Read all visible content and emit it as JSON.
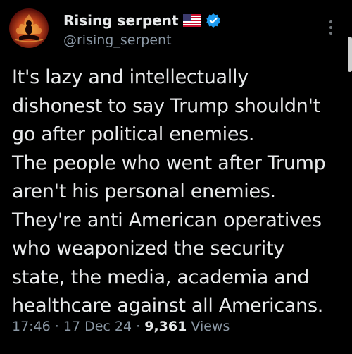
{
  "author": {
    "display_name": "Rising serpent",
    "flag_emoji": "🇺🇸",
    "handle": "@rising_serpent",
    "verified": true,
    "verified_color": "#1d9bf0",
    "avatar_icon": "serpent-flame-avatar"
  },
  "tweet": {
    "lines": [
      "It's lazy and intellectually",
      "dishonest to say Trump shouldn't",
      "go after political enemies.",
      "The people who went after Trump",
      "aren't his personal enemies.",
      "They're anti American operatives",
      "who weaponized the security",
      "state, the media, academia and",
      "healthcare against all Americans."
    ]
  },
  "meta": {
    "time": "17:46",
    "separator": " · ",
    "date": "17 Dec 24",
    "views_count": "9,361",
    "views_label": "Views"
  },
  "colors": {
    "background": "#000000",
    "text": "#e7e9ea",
    "secondary_text": "#8b98a5"
  }
}
